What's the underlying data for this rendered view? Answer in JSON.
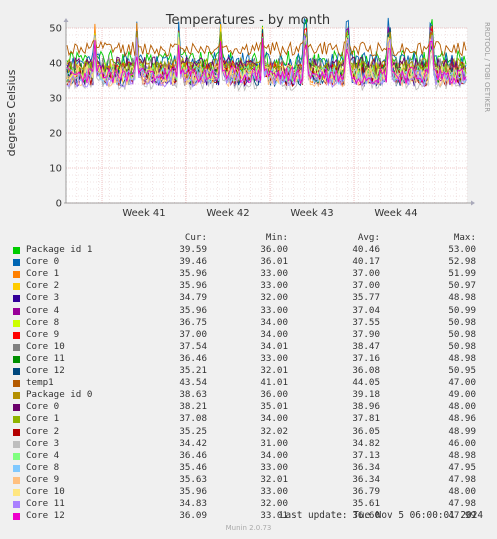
{
  "chart_data": {
    "type": "line",
    "title": "Temperatures - by month",
    "ylabel": "degrees Celsius",
    "side_label": "RRDTOOL / TOBI OETIKER",
    "ylim": [
      0,
      50
    ],
    "yticks": [
      0,
      10,
      20,
      30,
      40,
      50
    ],
    "xticks": [
      "Week 41",
      "Week 42",
      "Week 43",
      "Week 44"
    ],
    "grid": true,
    "columns": [
      "Cur:",
      "Min:",
      "Avg:",
      "Max:"
    ],
    "series": [
      {
        "name": "Package id 1",
        "color": "#00cc00",
        "cur": "39.59",
        "min": "36.00",
        "avg": "40.46",
        "max": "53.00"
      },
      {
        "name": "Core 0",
        "color": "#0066b3",
        "cur": "39.46",
        "min": "36.01",
        "avg": "40.17",
        "max": "52.98"
      },
      {
        "name": "Core 1",
        "color": "#ff8000",
        "cur": "35.96",
        "min": "33.00",
        "avg": "37.00",
        "max": "51.99"
      },
      {
        "name": "Core 2",
        "color": "#ffcc00",
        "cur": "35.96",
        "min": "33.00",
        "avg": "37.00",
        "max": "50.97"
      },
      {
        "name": "Core 3",
        "color": "#330099",
        "cur": "34.79",
        "min": "32.00",
        "avg": "35.77",
        "max": "48.98"
      },
      {
        "name": "Core 4",
        "color": "#990099",
        "cur": "35.96",
        "min": "33.00",
        "avg": "37.04",
        "max": "50.99"
      },
      {
        "name": "Core 8",
        "color": "#ccff00",
        "cur": "36.75",
        "min": "34.00",
        "avg": "37.55",
        "max": "50.98"
      },
      {
        "name": "Core 9",
        "color": "#ff0000",
        "cur": "37.00",
        "min": "34.00",
        "avg": "37.90",
        "max": "50.98"
      },
      {
        "name": "Core 10",
        "color": "#808080",
        "cur": "37.54",
        "min": "34.01",
        "avg": "38.47",
        "max": "50.98"
      },
      {
        "name": "Core 11",
        "color": "#008f00",
        "cur": "36.46",
        "min": "33.00",
        "avg": "37.16",
        "max": "48.98"
      },
      {
        "name": "Core 12",
        "color": "#00487d",
        "cur": "35.21",
        "min": "32.01",
        "avg": "36.08",
        "max": "50.95"
      },
      {
        "name": "temp1",
        "color": "#b35a00",
        "cur": "43.54",
        "min": "41.01",
        "avg": "44.05",
        "max": "47.00"
      },
      {
        "name": "Package id 0",
        "color": "#b38f00",
        "cur": "38.63",
        "min": "36.00",
        "avg": "39.18",
        "max": "49.00"
      },
      {
        "name": "Core 0",
        "color": "#6b006b",
        "cur": "38.21",
        "min": "35.01",
        "avg": "38.96",
        "max": "48.00"
      },
      {
        "name": "Core 1",
        "color": "#8fb300",
        "cur": "37.08",
        "min": "34.00",
        "avg": "37.81",
        "max": "48.96"
      },
      {
        "name": "Core 2",
        "color": "#b30000",
        "cur": "35.25",
        "min": "32.02",
        "avg": "36.05",
        "max": "48.99"
      },
      {
        "name": "Core 3",
        "color": "#bebebe",
        "cur": "34.42",
        "min": "31.00",
        "avg": "34.82",
        "max": "46.00"
      },
      {
        "name": "Core 4",
        "color": "#80ff80",
        "cur": "36.46",
        "min": "34.00",
        "avg": "37.13",
        "max": "48.98"
      },
      {
        "name": "Core 8",
        "color": "#80c9ff",
        "cur": "35.46",
        "min": "33.00",
        "avg": "36.34",
        "max": "47.95"
      },
      {
        "name": "Core 9",
        "color": "#ffc080",
        "cur": "35.63",
        "min": "32.01",
        "avg": "36.34",
        "max": "47.98"
      },
      {
        "name": "Core 10",
        "color": "#ffe680",
        "cur": "35.96",
        "min": "33.00",
        "avg": "36.79",
        "max": "48.00"
      },
      {
        "name": "Core 11",
        "color": "#aa80ff",
        "cur": "34.83",
        "min": "32.00",
        "avg": "35.61",
        "max": "47.98"
      },
      {
        "name": "Core 12",
        "color": "#ee00cc",
        "cur": "36.09",
        "min": "33.01",
        "avg": "36.60",
        "max": "47.99"
      }
    ]
  },
  "footer": {
    "last_update": "Last update: Tue Nov  5 06:00:01 2024",
    "version": "Munin 2.0.73"
  }
}
